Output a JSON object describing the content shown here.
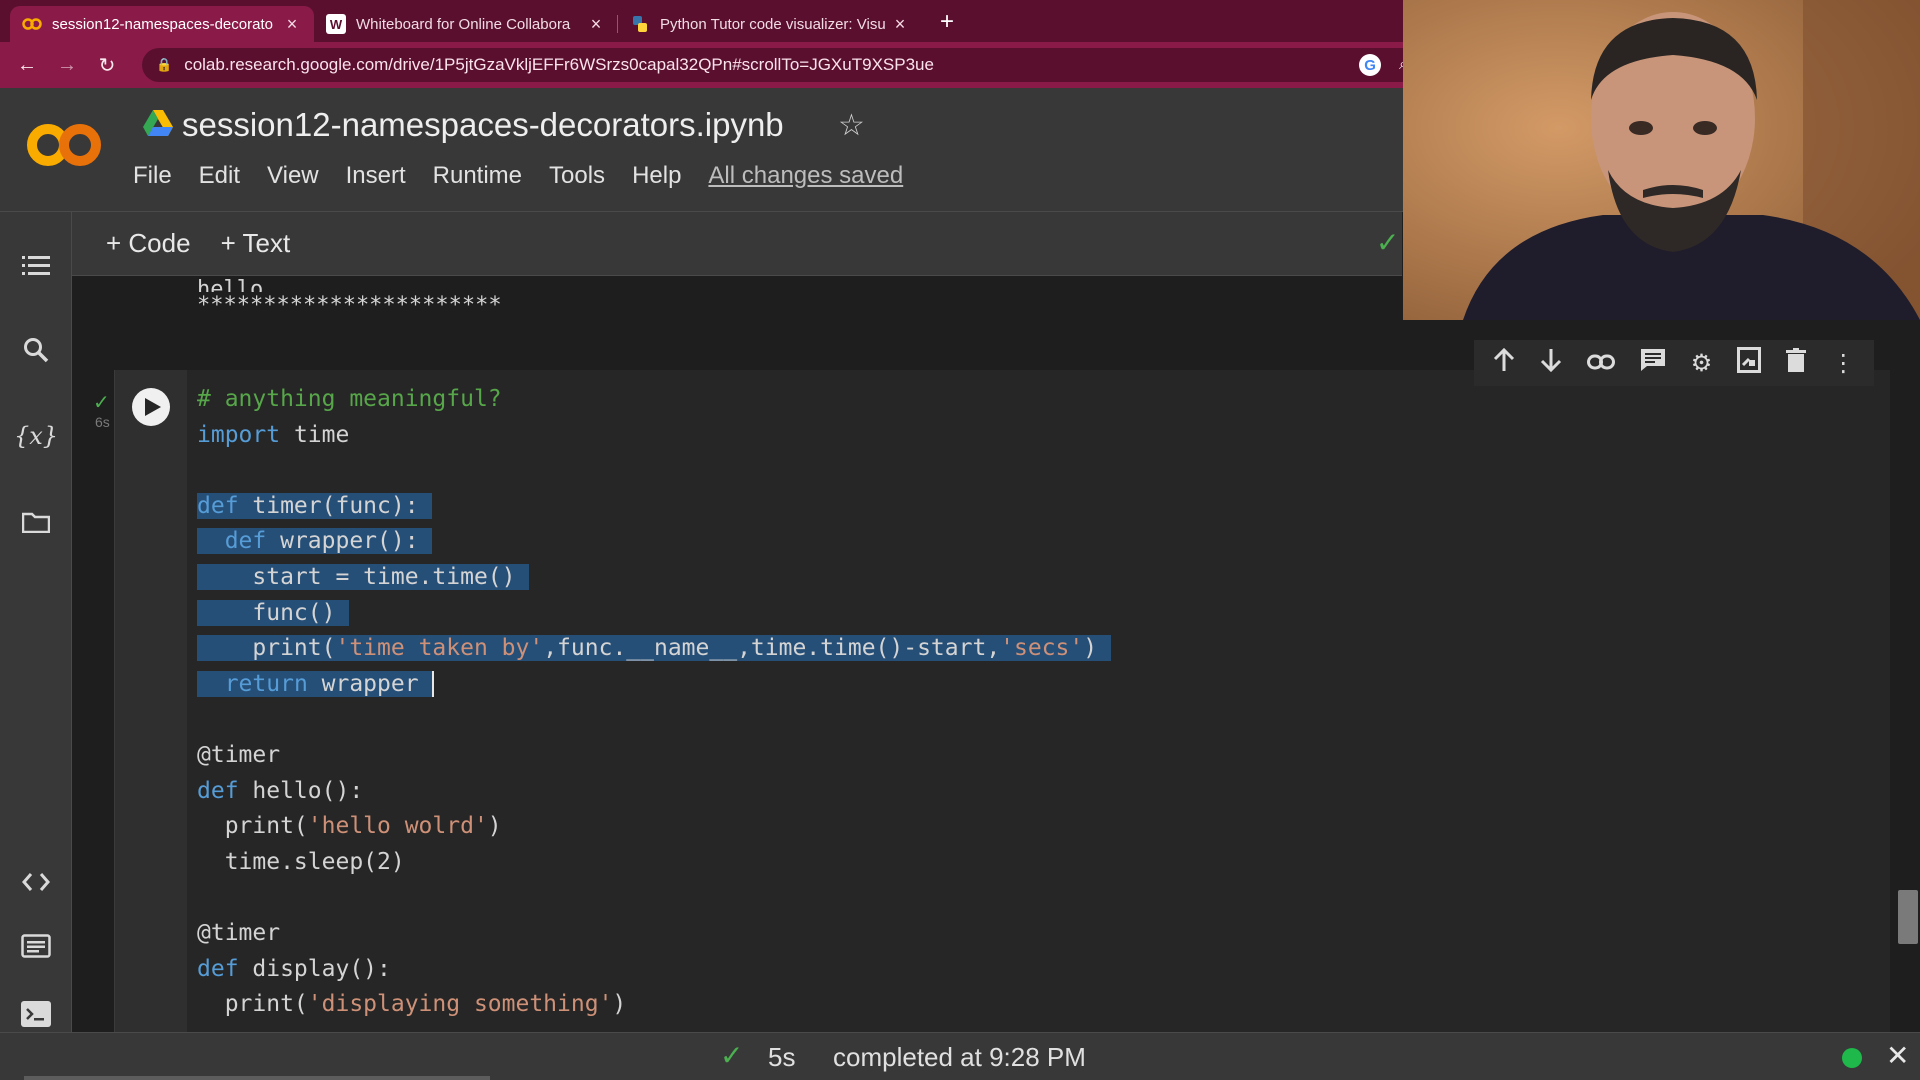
{
  "browser": {
    "tabs": [
      {
        "title": "session12-namespaces-decorato",
        "favicon": "colab-icon",
        "active": true
      },
      {
        "title": "Whiteboard for Online Collabora",
        "favicon": "W",
        "active": false
      },
      {
        "title": "Python Tutor code visualizer: Visu",
        "favicon": "python-icon",
        "active": false
      }
    ],
    "url": "colab.research.google.com/drive/1P5jtGzaVkljEFFr6WSrzs0capal32QPn#scrollTo=JGXuT9XSP3ue",
    "google_badge": "G"
  },
  "colab": {
    "logo": "CO",
    "notebook_title": "session12-namespaces-decorators.ipynb",
    "menu": [
      "File",
      "Edit",
      "View",
      "Insert",
      "Runtime",
      "Tools",
      "Help"
    ],
    "save_status": "All changes saved",
    "add_code": "+ Code",
    "add_text": "+ Text"
  },
  "previous_output": {
    "line1": "hello",
    "line2": "***********************"
  },
  "cell": {
    "exec_time": "6s",
    "lines": [
      {
        "parts": [
          {
            "t": "# anything meaningful?",
            "c": "cm"
          }
        ]
      },
      {
        "parts": [
          {
            "t": "import",
            "c": "kw"
          },
          {
            "t": " time",
            "c": ""
          }
        ]
      },
      {
        "parts": [
          {
            "t": "",
            "c": ""
          }
        ]
      },
      {
        "sel": true,
        "parts": [
          {
            "t": "def",
            "c": "kw"
          },
          {
            "t": " timer(func):",
            "c": ""
          }
        ]
      },
      {
        "sel": true,
        "parts": [
          {
            "t": "  ",
            "c": ""
          },
          {
            "t": "def",
            "c": "kw"
          },
          {
            "t": " wrapper():",
            "c": ""
          }
        ]
      },
      {
        "sel": true,
        "parts": [
          {
            "t": "    start = time.time()",
            "c": ""
          }
        ]
      },
      {
        "sel": true,
        "parts": [
          {
            "t": "    func()",
            "c": ""
          }
        ]
      },
      {
        "sel": true,
        "parts": [
          {
            "t": "    print(",
            "c": ""
          },
          {
            "t": "'time taken by'",
            "c": "st"
          },
          {
            "t": ",func.__name__,time.time()-start,",
            "c": ""
          },
          {
            "t": "'secs'",
            "c": "st"
          },
          {
            "t": ")",
            "c": ""
          }
        ]
      },
      {
        "sel": true,
        "cursor": true,
        "parts": [
          {
            "t": "  ",
            "c": ""
          },
          {
            "t": "return",
            "c": "kw"
          },
          {
            "t": " wrapper",
            "c": ""
          }
        ]
      },
      {
        "parts": [
          {
            "t": "",
            "c": ""
          }
        ]
      },
      {
        "parts": [
          {
            "t": "@timer",
            "c": ""
          }
        ]
      },
      {
        "parts": [
          {
            "t": "def",
            "c": "kw"
          },
          {
            "t": " hello():",
            "c": ""
          }
        ]
      },
      {
        "parts": [
          {
            "t": "  print(",
            "c": ""
          },
          {
            "t": "'hello wolrd'",
            "c": "st"
          },
          {
            "t": ")",
            "c": ""
          }
        ]
      },
      {
        "parts": [
          {
            "t": "  time.sleep(2)",
            "c": ""
          }
        ]
      },
      {
        "parts": [
          {
            "t": "",
            "c": ""
          }
        ]
      },
      {
        "parts": [
          {
            "t": "@timer",
            "c": ""
          }
        ]
      },
      {
        "parts": [
          {
            "t": "def",
            "c": "kw"
          },
          {
            "t": " display():",
            "c": ""
          }
        ]
      },
      {
        "parts": [
          {
            "t": "  print(",
            "c": ""
          },
          {
            "t": "'displaying something'",
            "c": "st"
          },
          {
            "t": ")",
            "c": ""
          }
        ]
      }
    ]
  },
  "cell_actions": [
    "move-up-icon",
    "move-down-icon",
    "link-icon",
    "comment-icon",
    "settings-icon",
    "mirror-cell-icon",
    "delete-icon",
    "more-icon"
  ],
  "status": {
    "time": "5s",
    "completed": "completed at 9:28 PM"
  },
  "colors": {
    "tab_bg": "#5b0f2f",
    "toolbar_bg": "#8a1b49",
    "selection": "#264f78",
    "keyword": "#569cd6",
    "string": "#ce9178",
    "comment": "#57a64a"
  }
}
